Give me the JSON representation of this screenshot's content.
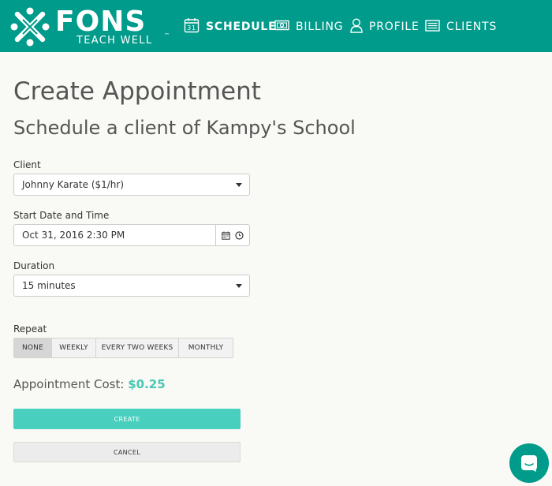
{
  "brand": {
    "name": "FONS",
    "tagline": "TEACH WELL",
    "tm": "™",
    "color": "#009b8a",
    "accent": "#48cfbd"
  },
  "nav": {
    "items": [
      {
        "label": "SCHEDULE",
        "icon": "calendar-icon",
        "icon_text": "31",
        "active": true
      },
      {
        "label": "BILLING",
        "icon": "money-icon",
        "active": false
      },
      {
        "label": "PROFILE",
        "icon": "user-icon",
        "active": false
      },
      {
        "label": "CLIENTS",
        "icon": "list-icon",
        "active": false
      }
    ]
  },
  "page": {
    "title": "Create Appointment",
    "subtitle": "Schedule a client of Kampy's School"
  },
  "form": {
    "client": {
      "label": "Client",
      "value": "Johnny Karate ($1/hr)"
    },
    "start": {
      "label": "Start Date and Time",
      "value": "Oct 31, 2016 2:30 PM"
    },
    "duration": {
      "label": "Duration",
      "value": "15 minutes"
    },
    "repeat": {
      "label": "Repeat",
      "options": [
        "NONE",
        "WEEKLY",
        "EVERY TWO WEEKS",
        "MONTHLY"
      ],
      "selected": "NONE"
    },
    "cost": {
      "label": "Appointment Cost:",
      "value": "$0.25"
    }
  },
  "actions": {
    "create": "CREATE",
    "cancel": "CANCEL"
  },
  "chat": {
    "icon": "chat-icon"
  }
}
